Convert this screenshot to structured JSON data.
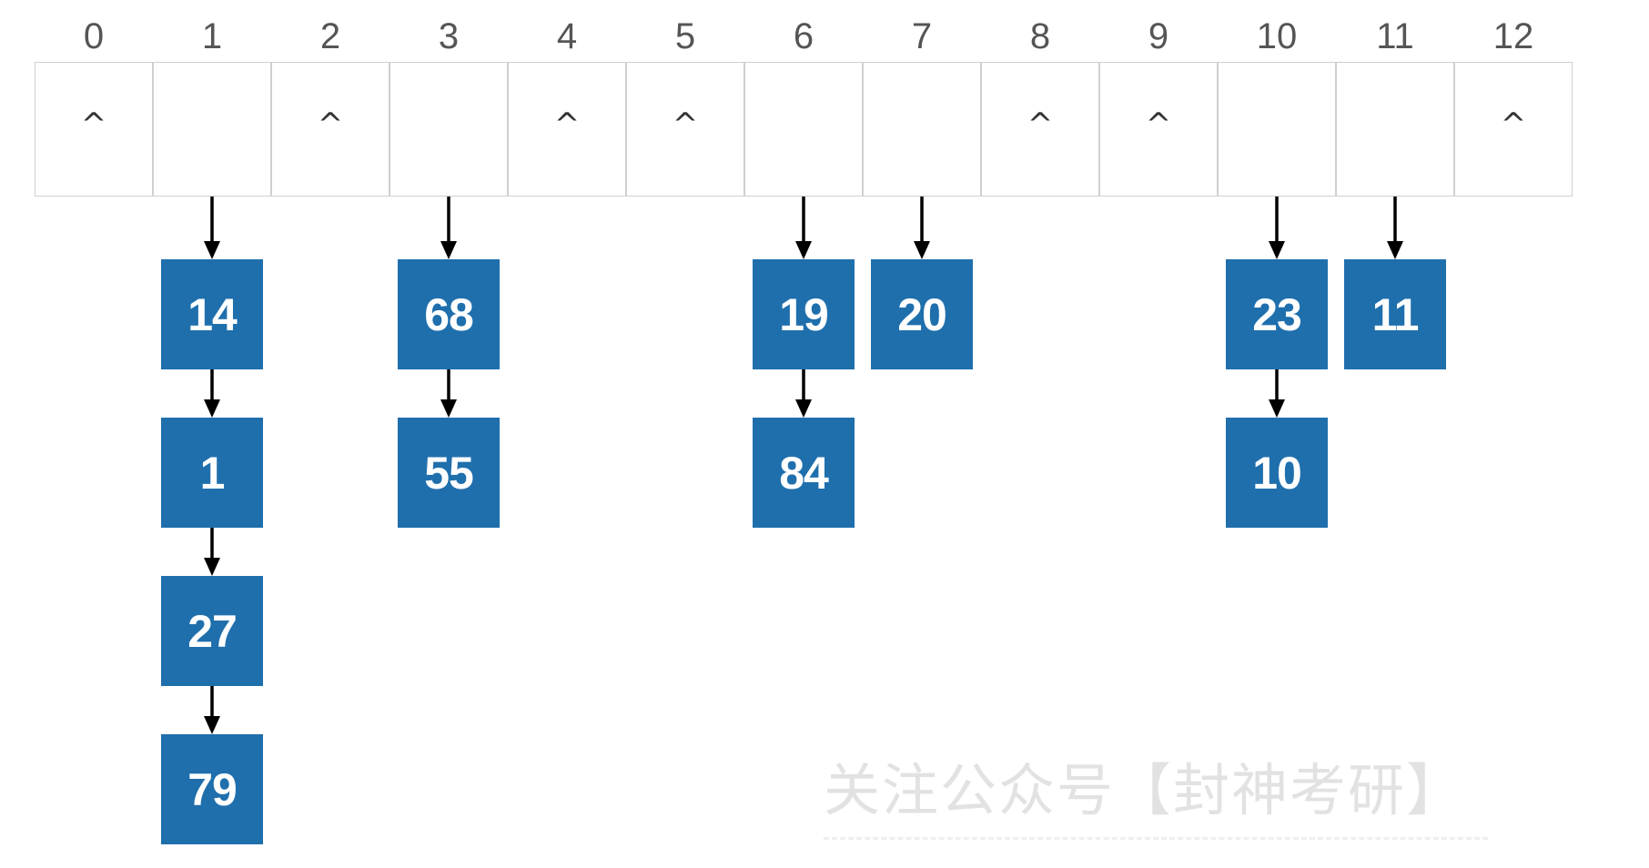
{
  "diagram": {
    "indices": [
      "0",
      "1",
      "2",
      "3",
      "4",
      "5",
      "6",
      "7",
      "8",
      "9",
      "10",
      "11",
      "12"
    ],
    "null_symbol": "^",
    "slots": [
      {
        "index": 0,
        "chain": []
      },
      {
        "index": 1,
        "chain": [
          "14",
          "1",
          "27",
          "79"
        ]
      },
      {
        "index": 2,
        "chain": []
      },
      {
        "index": 3,
        "chain": [
          "68",
          "55"
        ]
      },
      {
        "index": 4,
        "chain": []
      },
      {
        "index": 5,
        "chain": []
      },
      {
        "index": 6,
        "chain": [
          "19",
          "84"
        ]
      },
      {
        "index": 7,
        "chain": [
          "20"
        ]
      },
      {
        "index": 8,
        "chain": []
      },
      {
        "index": 9,
        "chain": []
      },
      {
        "index": 10,
        "chain": [
          "23",
          "10"
        ]
      },
      {
        "index": 11,
        "chain": [
          "11"
        ]
      },
      {
        "index": 12,
        "chain": []
      }
    ],
    "colors": {
      "node_fill": "#1f6fad",
      "node_text": "#ffffff",
      "arrow": "#000000",
      "cell_border": "#cfcfcf"
    }
  },
  "watermark": {
    "text": "关注公众号【封神考研】"
  }
}
